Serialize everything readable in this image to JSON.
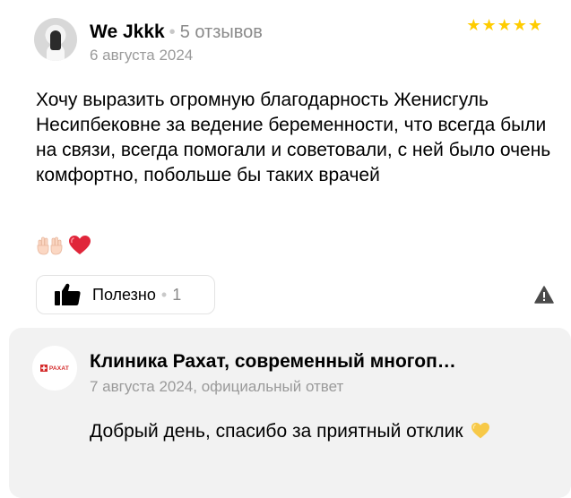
{
  "review": {
    "author": "We Jkkk",
    "separator": "•",
    "reviews_count": "5 отзывов",
    "date": "6 августа 2024",
    "rating": 5,
    "stars": [
      "★",
      "★",
      "★",
      "★",
      "★"
    ],
    "text": "Хочу выразить огромную благодарность Женисгуль Несипбековне за ведение беременности, что всегда были на связи, всегда помогали и советовали, с ней было очень комфортно, побольше бы таких врачей",
    "emojis": [
      "raised-hands-emoji",
      "red-heart-emoji"
    ]
  },
  "actions": {
    "useful_label": "Полезно",
    "separator": "•",
    "useful_count": "1",
    "report_icon": "warning-icon"
  },
  "reply": {
    "logo_text": "РАХАТ",
    "clinic_name": "Клиника Рахат, современный многоп…",
    "date": "7 августа 2024, официальный ответ",
    "text": "Добрый день, спасибо за приятный отклик",
    "emoji": "yellow-heart-emoji"
  },
  "colors": {
    "star": "#ffcc00",
    "heart_red": "#e0263a",
    "heart_yellow": "#f7c948",
    "reply_background": "#f2f2f2",
    "logo_red": "#d42b2b"
  }
}
